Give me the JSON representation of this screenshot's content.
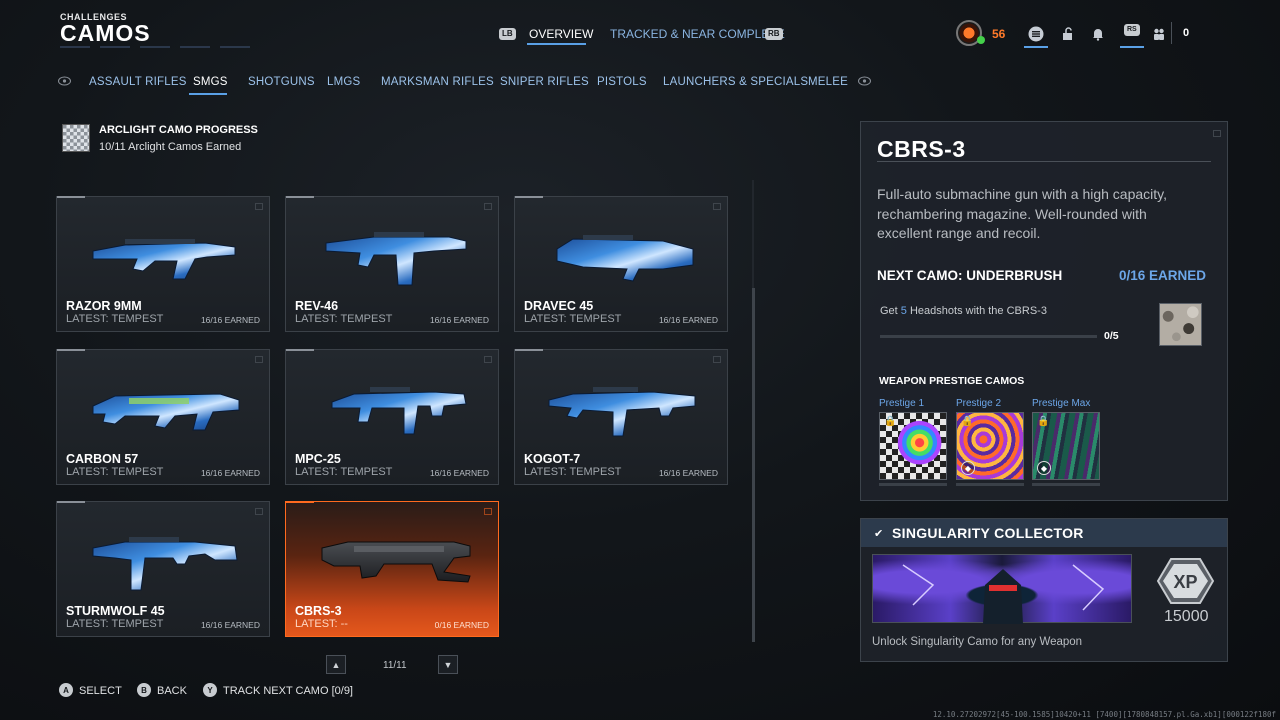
{
  "header": {
    "subtitle": "CHALLENGES",
    "title": "CAMOS",
    "lb": "LB",
    "rb": "RB",
    "tabs": [
      {
        "label": "OVERVIEW",
        "active": true
      },
      {
        "label": "TRACKED & NEAR COMPLETE",
        "active": false
      }
    ],
    "level": "56",
    "rs": "RS",
    "count": "0"
  },
  "categories": [
    {
      "label": "ASSAULT RIFLES",
      "active": false
    },
    {
      "label": "SMGS",
      "active": true
    },
    {
      "label": "SHOTGUNS",
      "active": false
    },
    {
      "label": "LMGS",
      "active": false
    },
    {
      "label": "MARKSMAN RIFLES",
      "active": false
    },
    {
      "label": "SNIPER RIFLES",
      "active": false
    },
    {
      "label": "PISTOLS",
      "active": false
    },
    {
      "label": "LAUNCHERS & SPECIALS",
      "active": false
    },
    {
      "label": "MELEE",
      "active": false
    }
  ],
  "arclight": {
    "title": "ARCLIGHT CAMO PROGRESS",
    "subtitle": "10/11 Arclight Camos Earned"
  },
  "weapons": [
    {
      "name": "RAZOR 9MM",
      "latest": "LATEST: TEMPEST",
      "earned": "16/16 EARNED"
    },
    {
      "name": "REV-46",
      "latest": "LATEST: TEMPEST",
      "earned": "16/16 EARNED"
    },
    {
      "name": "DRAVEC 45",
      "latest": "LATEST: TEMPEST",
      "earned": "16/16 EARNED"
    },
    {
      "name": "CARBON 57",
      "latest": "LATEST: TEMPEST",
      "earned": "16/16 EARNED"
    },
    {
      "name": "MPC-25",
      "latest": "LATEST: TEMPEST",
      "earned": "16/16 EARNED"
    },
    {
      "name": "KOGOT-7",
      "latest": "LATEST: TEMPEST",
      "earned": "16/16 EARNED"
    },
    {
      "name": "STURMWOLF 45",
      "latest": "LATEST: TEMPEST",
      "earned": "16/16 EARNED"
    },
    {
      "name": "CBRS-3",
      "latest": "LATEST: --",
      "earned": "0/16 EARNED",
      "selected": true
    }
  ],
  "pager": {
    "text": "11/11"
  },
  "footer": [
    {
      "key": "A",
      "label": "SELECT"
    },
    {
      "key": "B",
      "label": "BACK"
    },
    {
      "key": "Y",
      "label": "TRACK NEXT CAMO [0/9]"
    }
  ],
  "build": "12.10.27202972[45-100.1585]10420+11 [7400][1780848157.pl.Ga.xb1][000122f180f",
  "detail": {
    "weapon": "CBRS-3",
    "description": "Full-auto submachine gun with a high capacity, rechambering magazine. Well-rounded with excellent range and recoil.",
    "next_camo": "NEXT CAMO: UNDERBRUSH",
    "next_earned": "0/16 EARNED",
    "task_pre": "Get ",
    "task_num": "5",
    "task_post": " Headshots with the CBRS-3",
    "task_count": "0/5",
    "task_progress": 0,
    "prestige_title": "WEAPON PRESTIGE CAMOS",
    "prestige": [
      {
        "label": "Prestige 1"
      },
      {
        "label": "Prestige 2"
      },
      {
        "label": "Prestige Max"
      }
    ]
  },
  "singularity": {
    "title": "SINGULARITY COLLECTOR",
    "xp_label": "XP",
    "xp": "15000",
    "description": "Unlock Singularity Camo for any Weapon"
  },
  "colors": {
    "accent_blue": "#5aa0e6",
    "selected_orange": "#e5581c",
    "level_orange": "#ff7a2a"
  }
}
